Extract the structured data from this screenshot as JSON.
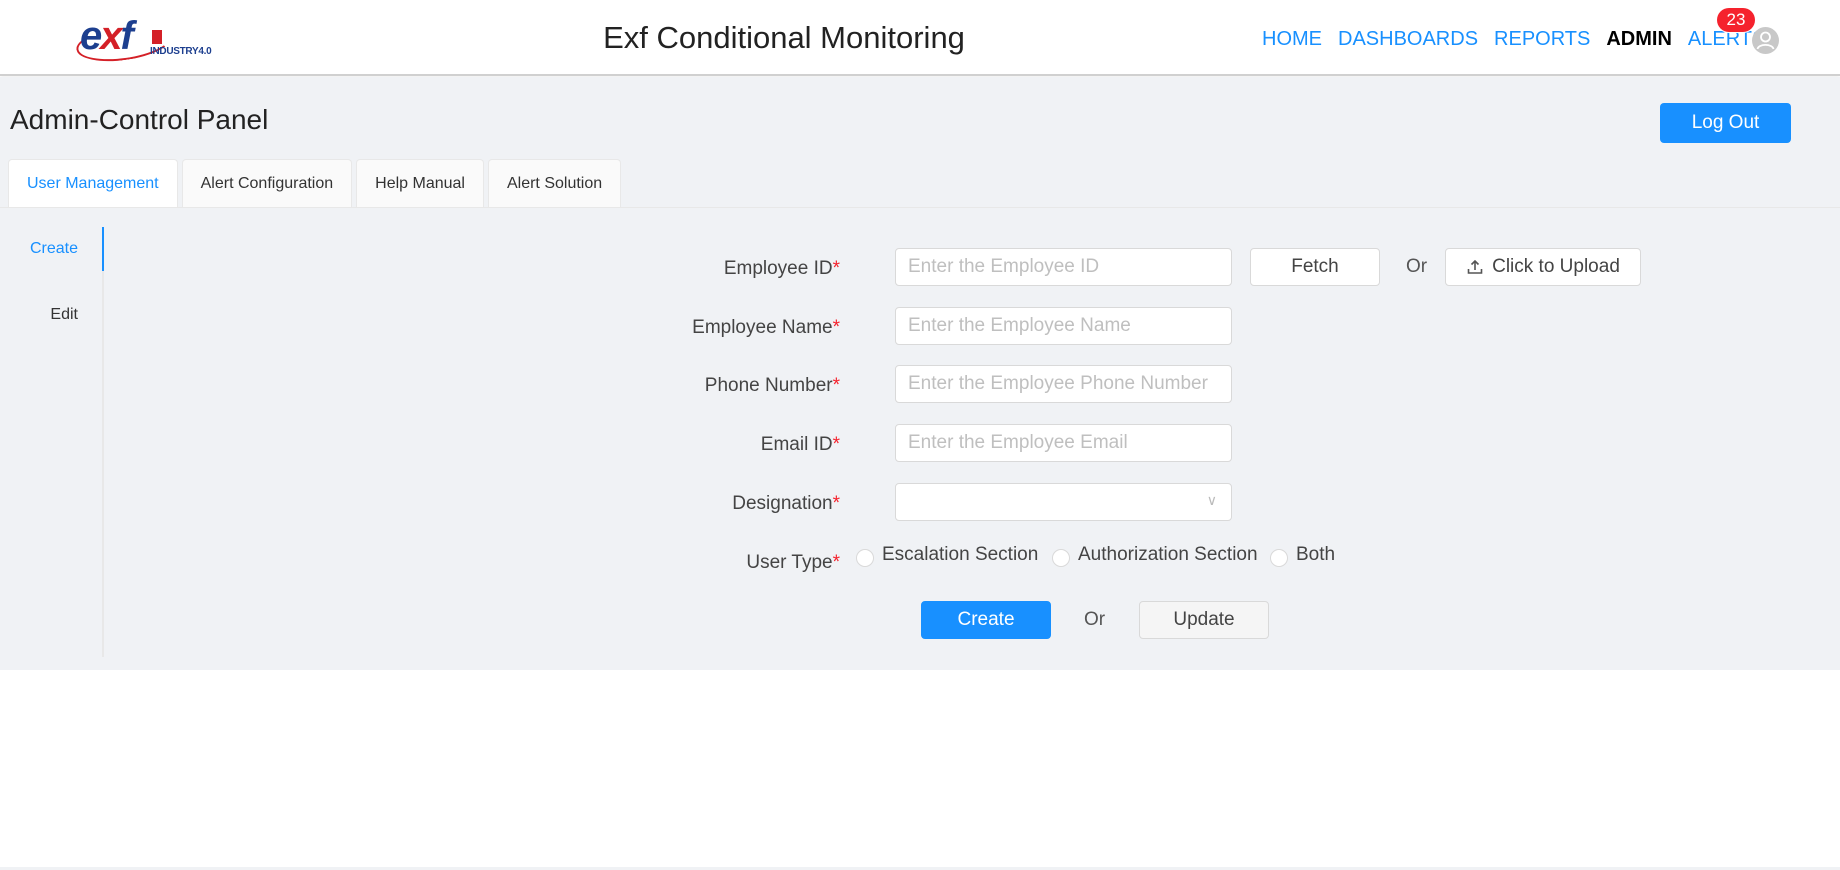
{
  "header": {
    "logo_text": "exf",
    "logo_subtext": "INDUSTRY4.0",
    "app_title": "Exf Conditional Monitoring",
    "nav": [
      {
        "label": "HOME",
        "active": false
      },
      {
        "label": "DASHBOARDS",
        "active": false
      },
      {
        "label": "REPORTS",
        "active": false
      },
      {
        "label": "ADMIN",
        "active": true
      },
      {
        "label": "ALERTS",
        "active": false
      }
    ],
    "alerts_count": "23",
    "avatar_icon": "user-icon"
  },
  "page": {
    "title": "Admin-Control Panel",
    "logout_label": "Log Out"
  },
  "tabs": [
    {
      "label": "User Management",
      "active": true
    },
    {
      "label": "Alert Configuration",
      "active": false
    },
    {
      "label": "Help Manual",
      "active": false
    },
    {
      "label": "Alert Solution",
      "active": false
    }
  ],
  "side_menu": [
    {
      "label": "Create",
      "active": true
    },
    {
      "label": "Edit",
      "active": false
    }
  ],
  "form": {
    "required_mark": "*",
    "employee_id": {
      "label": "Employee ID",
      "placeholder": "Enter the Employee ID",
      "value": ""
    },
    "fetch_label": "Fetch",
    "or_label": "Or",
    "upload_label": "Click to Upload",
    "employee_name": {
      "label": "Employee Name",
      "placeholder": "Enter the Employee Name",
      "value": ""
    },
    "phone_number": {
      "label": "Phone Number",
      "placeholder": "Enter the Employee Phone Number",
      "value": ""
    },
    "email_id": {
      "label": "Email ID",
      "placeholder": "Enter the Employee Email",
      "value": ""
    },
    "designation": {
      "label": "Designation",
      "selected": ""
    },
    "user_type": {
      "label": "User Type",
      "options": [
        "Escalation Section",
        "Authorization Section",
        "Both"
      ],
      "selected": null
    },
    "create_label": "Create",
    "update_label": "Update"
  },
  "colors": {
    "accent": "#1890ff",
    "badge": "#f5222d",
    "background": "#f0f2f5"
  }
}
